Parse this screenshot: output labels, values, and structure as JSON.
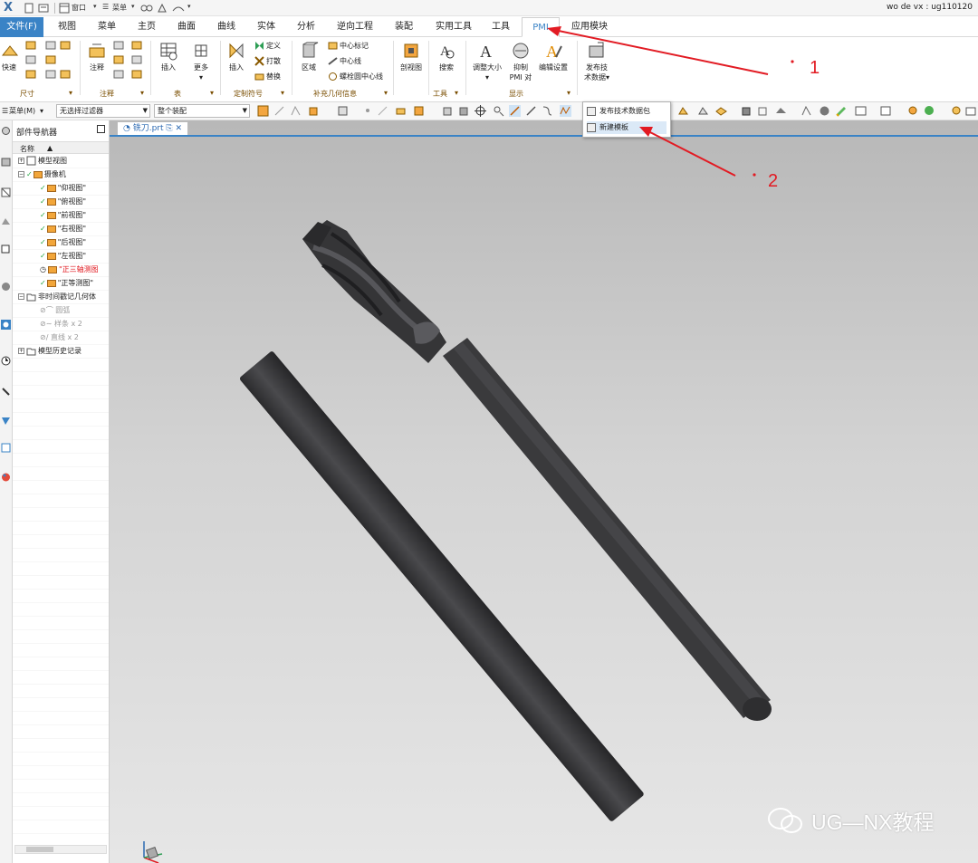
{
  "titlebar": {
    "logo": "X",
    "window_label": "窗口",
    "menu_label": "菜单",
    "user": "wo de vx : ug110120"
  },
  "menubar": {
    "file_tab": "文件(F)",
    "tabs": [
      "视图",
      "菜单",
      "主页",
      "曲面",
      "曲线",
      "实体",
      "分析",
      "逆向工程",
      "装配",
      "实用工具",
      "工具",
      "PMI",
      "应用模块"
    ],
    "active_index": 11
  },
  "ribbon": {
    "dimension": {
      "quick_label": "快速",
      "group_label": "尺寸"
    },
    "annotation": {
      "label": "注释",
      "group_label": "注释"
    },
    "table": {
      "insert_label": "插入",
      "more_label": "更多",
      "group_label": "表"
    },
    "custom_symbol": {
      "insert_label": "插入",
      "define_label": "定义",
      "open_label": "打散",
      "replace_label": "替换",
      "group_label": "定制符号"
    },
    "supp_geometry": {
      "region_label": "区域",
      "center_mark": "中心标记",
      "center_line": "中心线",
      "bolt_circle": "螺栓圆中心线",
      "group_label": "补充几何信息"
    },
    "section_view_label": "剖视图",
    "tools": {
      "search_label": "搜索",
      "group_label": "工具"
    },
    "display": {
      "resize_label": "调整大小",
      "suppress_line1": "抑制",
      "suppress_line2": "PMI 对",
      "edit_settings_label": "编辑设置",
      "group_label": "显示"
    },
    "publish": {
      "line1": "发布技",
      "line2": "术数据"
    }
  },
  "toolbar2": {
    "menu_label": "菜单(M)",
    "filter_value": "无选择过滤器",
    "assembly_value": "整个装配"
  },
  "navigator": {
    "title": "部件导航器",
    "column_name": "名称",
    "rows": [
      {
        "label": "模型视图",
        "indent": 0,
        "type": "folder-exp"
      },
      {
        "label": "摄像机",
        "indent": 0,
        "type": "camera-exp"
      },
      {
        "label": "\"仰视图\"",
        "indent": 2,
        "type": "view"
      },
      {
        "label": "\"俯视图\"",
        "indent": 2,
        "type": "view"
      },
      {
        "label": "\"前视图\"",
        "indent": 2,
        "type": "view"
      },
      {
        "label": "\"右视图\"",
        "indent": 2,
        "type": "view"
      },
      {
        "label": "\"后视图\"",
        "indent": 2,
        "type": "view"
      },
      {
        "label": "\"左视图\"",
        "indent": 2,
        "type": "view"
      },
      {
        "label": "\"正三轴测图",
        "indent": 2,
        "type": "view-active"
      },
      {
        "label": "\"正等测图\"",
        "indent": 2,
        "type": "view"
      },
      {
        "label": "非时间戳记几何体",
        "indent": 0,
        "type": "folder-open"
      },
      {
        "label": "圆弧",
        "indent": 2,
        "type": "geom"
      },
      {
        "label": "样条 x 2",
        "indent": 2,
        "type": "geom"
      },
      {
        "label": "直线 x 2",
        "indent": 2,
        "type": "geom"
      },
      {
        "label": "模型历史记录",
        "indent": 0,
        "type": "folder-exp"
      }
    ]
  },
  "viewport": {
    "tab_label": "铣刀.prt"
  },
  "popup": {
    "items": [
      "发布技术数据包",
      "新建模板"
    ],
    "highlighted_index": 1
  },
  "annotations": {
    "step1": "1",
    "step2": "2",
    "color": "#e21b23"
  },
  "watermark": "UG—NX教程",
  "colors": {
    "accent": "#3a83c6",
    "tool_body": "#3a3a3c"
  }
}
